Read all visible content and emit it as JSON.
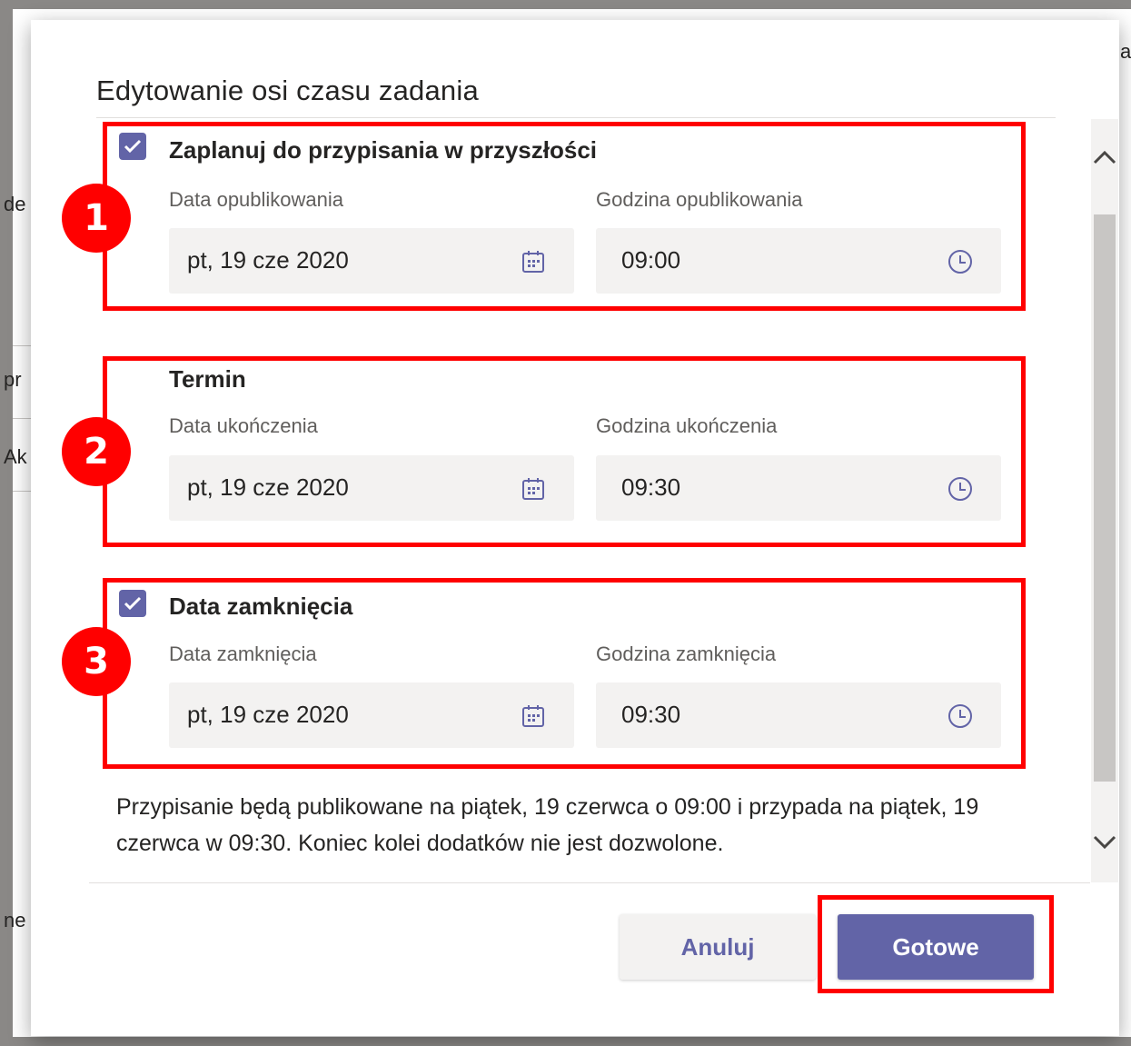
{
  "dialog": {
    "title": "Edytowanie osi czasu zadania"
  },
  "background_fragments": {
    "frag1": "de",
    "frag2": "pr",
    "frag3": "Ak",
    "frag4": "ne",
    "frag_right": "a"
  },
  "sections": [
    {
      "number": "1",
      "checked": true,
      "label": "Zaplanuj do przypisania w przyszłości",
      "date_label": "Data opublikowania",
      "date_value": "pt, 19 cze 2020",
      "time_label": "Godzina opublikowania",
      "time_value": "09:00"
    },
    {
      "number": "2",
      "checked": false,
      "label": "Termin",
      "date_label": "Data ukończenia",
      "date_value": "pt, 19 cze 2020",
      "time_label": "Godzina ukończenia",
      "time_value": "09:30"
    },
    {
      "number": "3",
      "checked": true,
      "label": "Data zamknięcia",
      "date_label": "Data zamknięcia",
      "date_value": "pt, 19 cze 2020",
      "time_label": "Godzina zamknięcia",
      "time_value": "09:30"
    }
  ],
  "summary": "Przypisanie będą publikowane na piątek, 19 czerwca o 09:00 i przypada na piątek, 19 czerwca w 09:30. Koniec kolei dodatków nie jest dozwolone.",
  "buttons": {
    "cancel": "Anuluj",
    "done": "Gotowe"
  },
  "colors": {
    "accent": "#6264a7",
    "annotation": "#ff0000",
    "field_bg": "#f3f2f1"
  },
  "icons": {
    "checkbox": "checkmark-icon",
    "date": "calendar-icon",
    "time": "clock-icon",
    "scroll_up": "chevron-up-icon",
    "scroll_down": "chevron-down-icon"
  }
}
